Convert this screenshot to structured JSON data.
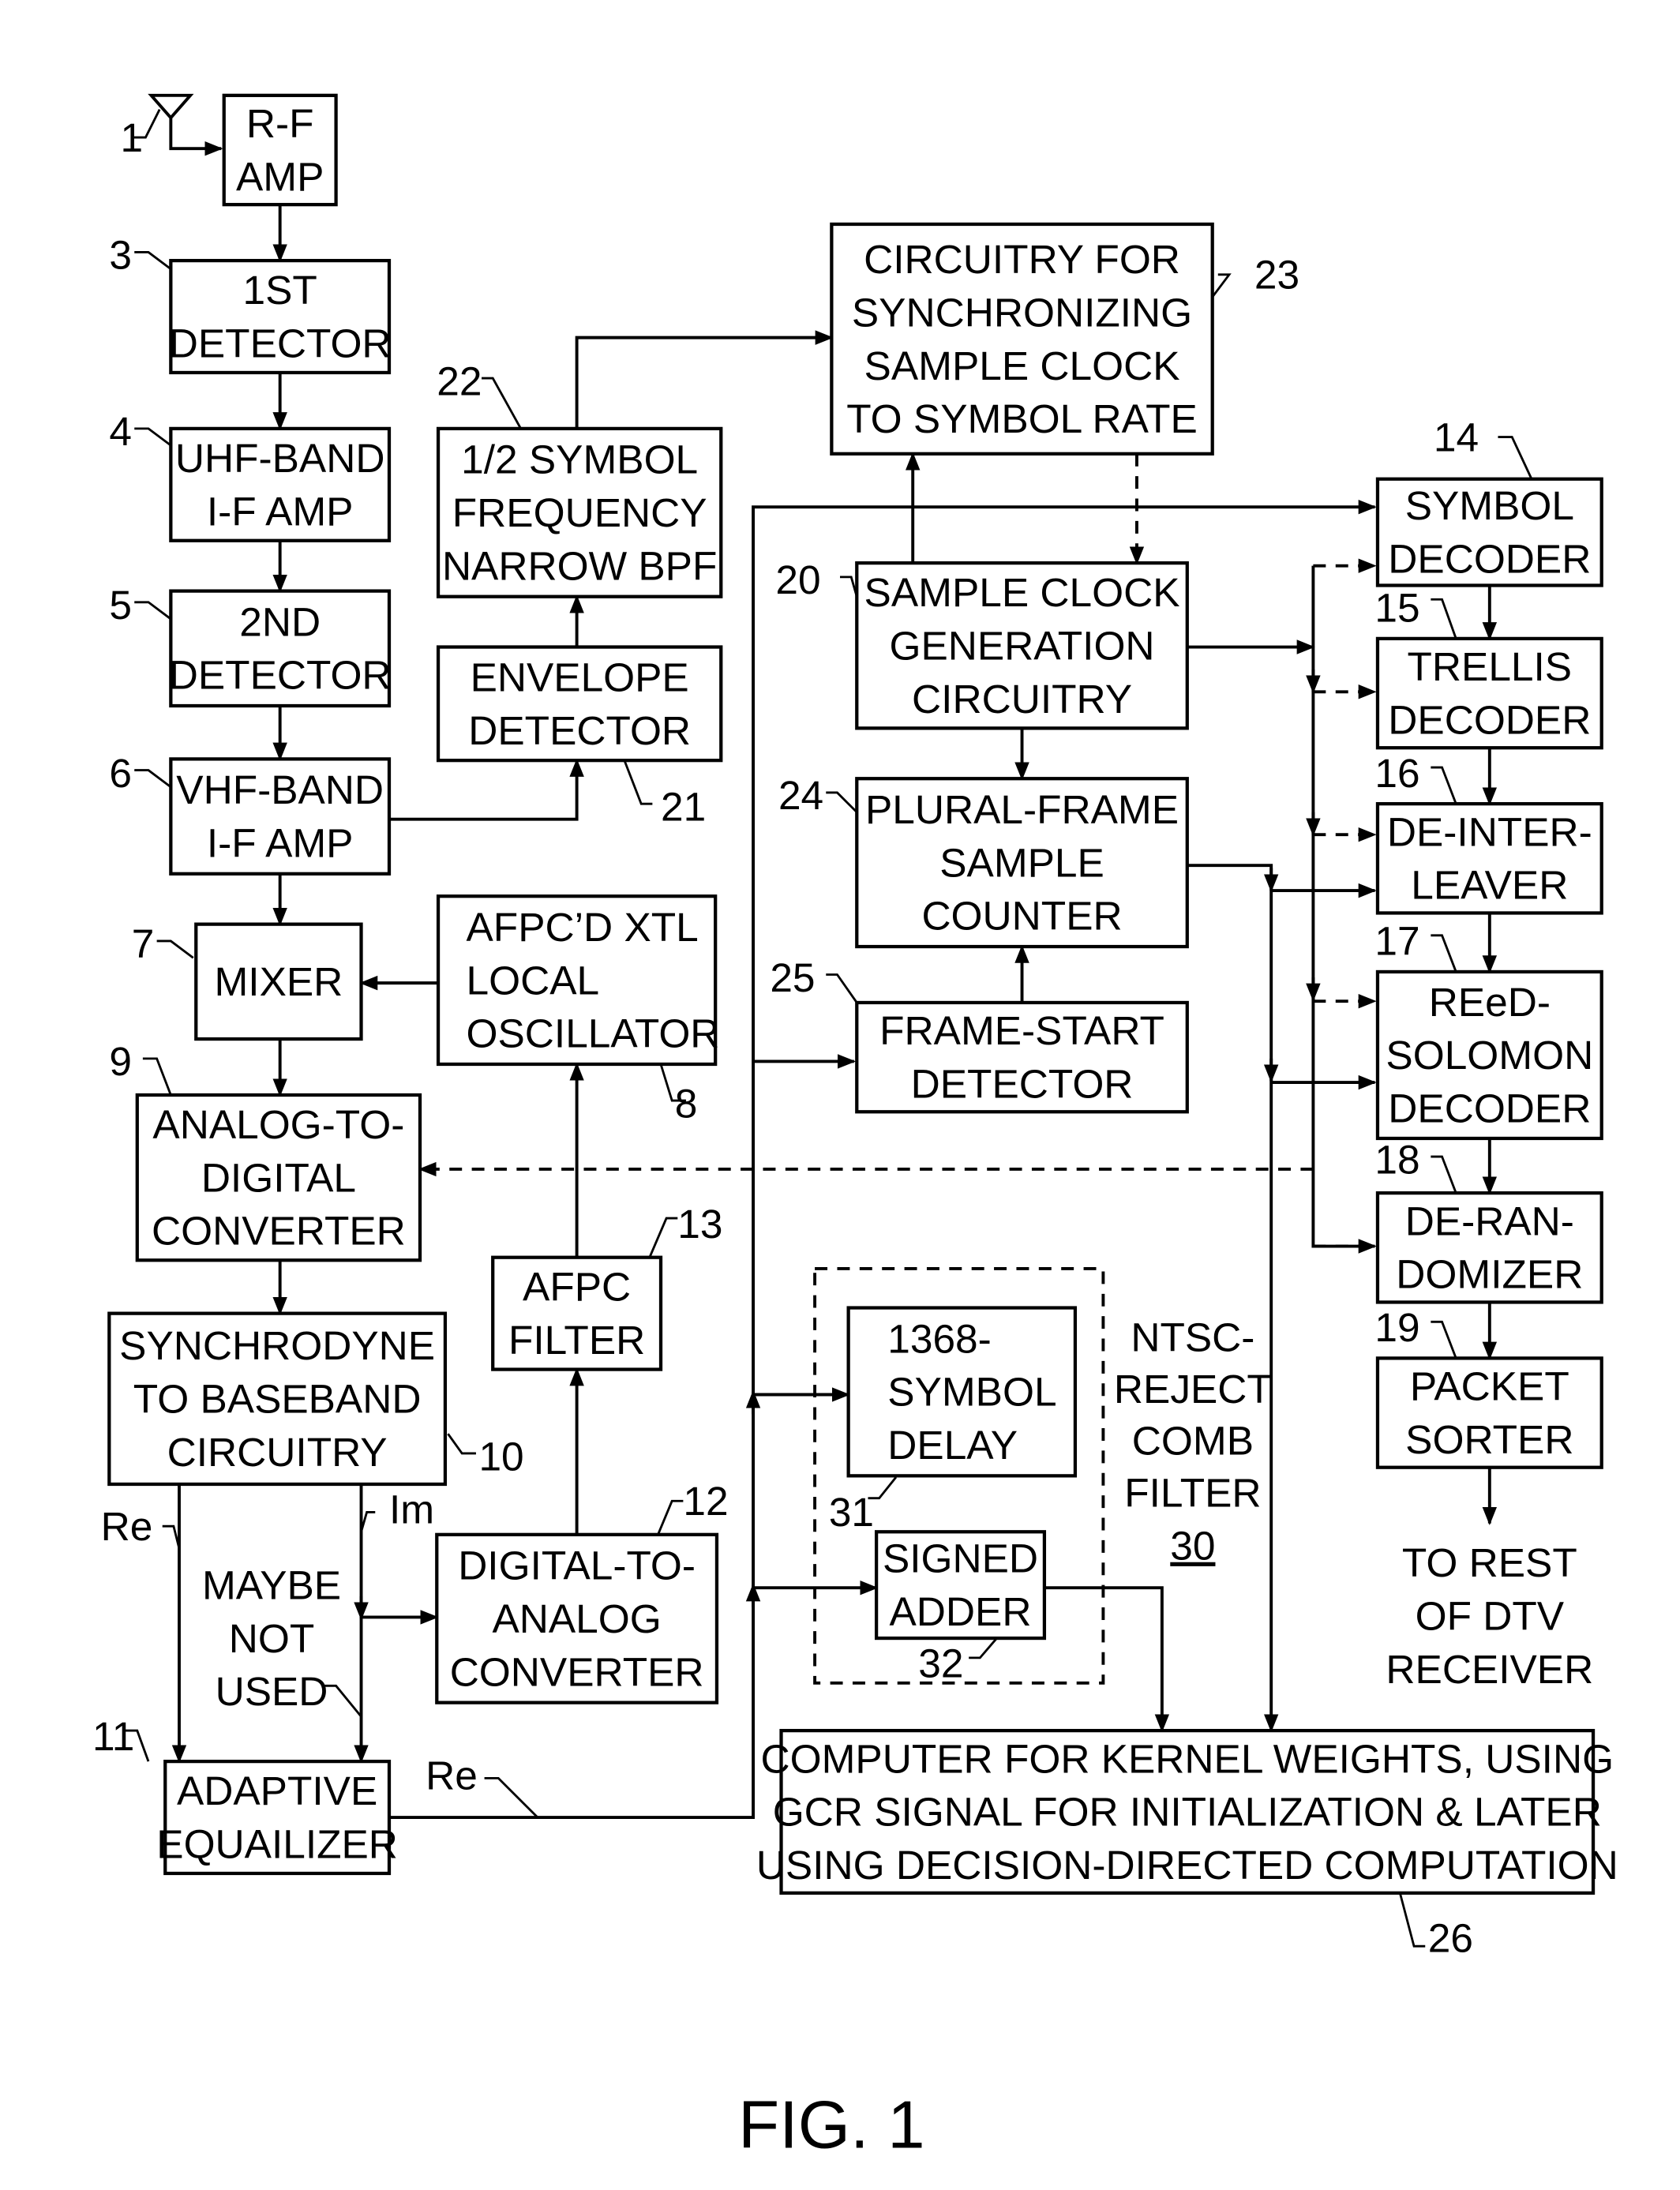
{
  "figure_caption": "FIG. 1",
  "blocks": {
    "rf_amp": {
      "ref": "1",
      "lines": [
        "R-F",
        "AMP"
      ]
    },
    "det1": {
      "ref": "3",
      "lines": [
        "1ST",
        "DETECTOR"
      ]
    },
    "uhf_if": {
      "ref": "4",
      "lines": [
        "UHF-BAND",
        "I-F AMP"
      ]
    },
    "det2": {
      "ref": "5",
      "lines": [
        "2ND",
        "DETECTOR"
      ]
    },
    "vhf_if": {
      "ref": "6",
      "lines": [
        "VHF-BAND",
        "I-F AMP"
      ]
    },
    "mixer": {
      "ref": "7",
      "lines": [
        "MIXER"
      ]
    },
    "local_osc": {
      "ref": "8",
      "lines": [
        "AFPC’D XTL",
        "LOCAL",
        "OSCILLATOR"
      ]
    },
    "adc": {
      "ref": "9",
      "lines": [
        "ANALOG-TO-",
        "DIGITAL",
        "CONVERTER"
      ]
    },
    "synchrodyne": {
      "ref": "10",
      "lines": [
        "SYNCHRODYNE",
        "TO BASEBAND",
        "CIRCUITRY"
      ]
    },
    "equalizer": {
      "ref": "11",
      "lines": [
        "ADAPTIVE",
        "EQUAILIZER"
      ]
    },
    "dac": {
      "ref": "12",
      "lines": [
        "DIGITAL-TO-",
        "ANALOG",
        "CONVERTER"
      ]
    },
    "afpc_filter": {
      "ref": "13",
      "lines": [
        "AFPC",
        "FILTER"
      ]
    },
    "symbol_dec": {
      "ref": "14",
      "lines": [
        "SYMBOL",
        "DECODER"
      ]
    },
    "trellis_dec": {
      "ref": "15",
      "lines": [
        "TRELLIS",
        "DECODER"
      ]
    },
    "deinterleaver": {
      "ref": "16",
      "lines": [
        "DE-INTER-",
        "LEAVER"
      ]
    },
    "rs_dec": {
      "ref": "17",
      "lines": [
        "REeD-",
        "SOLOMON",
        "DECODER"
      ]
    },
    "derandomizer": {
      "ref": "18",
      "lines": [
        "DE-RAN-",
        "DOMIZER"
      ]
    },
    "packet_sorter": {
      "ref": "19",
      "lines": [
        "PACKET",
        "SORTER"
      ]
    },
    "sample_clock": {
      "ref": "20",
      "lines": [
        "SAMPLE CLOCK",
        "GENERATION",
        "CIRCUITRY"
      ]
    },
    "envelope_det": {
      "ref": "21",
      "lines": [
        "ENVELOPE",
        "DETECTOR"
      ]
    },
    "bpf": {
      "ref": "22",
      "lines": [
        "1/2 SYMBOL",
        "FREQUENCY",
        "NARROW BPF"
      ]
    },
    "sync_circuit": {
      "ref": "23",
      "lines": [
        "CIRCUITRY FOR",
        "SYNCHRONIZING",
        "SAMPLE CLOCK",
        "TO SYMBOL RATE"
      ]
    },
    "frame_counter": {
      "ref": "24",
      "lines": [
        "PLURAL-FRAME",
        "SAMPLE",
        "COUNTER"
      ]
    },
    "frame_start": {
      "ref": "25",
      "lines": [
        "FRAME-START",
        "DETECTOR"
      ]
    },
    "kernel_comp": {
      "ref": "26",
      "lines": [
        "COMPUTER FOR KERNEL WEIGHTS, USING",
        "GCR SIGNAL FOR INITIALIZATION & LATER",
        "USING DECISION-DIRECTED COMPUTATION"
      ]
    },
    "delay": {
      "ref": "31",
      "lines": [
        "1368-",
        "SYMBOL",
        "DELAY"
      ]
    },
    "adder": {
      "ref": "32",
      "lines": [
        "SIGNED",
        "ADDER"
      ]
    }
  },
  "comb_filter": {
    "ref": "30",
    "lines": [
      "NTSC-",
      "REJECT",
      "COMB",
      "FILTER"
    ]
  },
  "signal_labels": {
    "re_left": "Re",
    "im": "Im",
    "re_bottom": "Re",
    "maybe_not_used": [
      "MAYBE",
      "NOT",
      "USED"
    ],
    "to_rest": [
      "TO REST",
      "OF DTV",
      "RECEIVER"
    ]
  }
}
